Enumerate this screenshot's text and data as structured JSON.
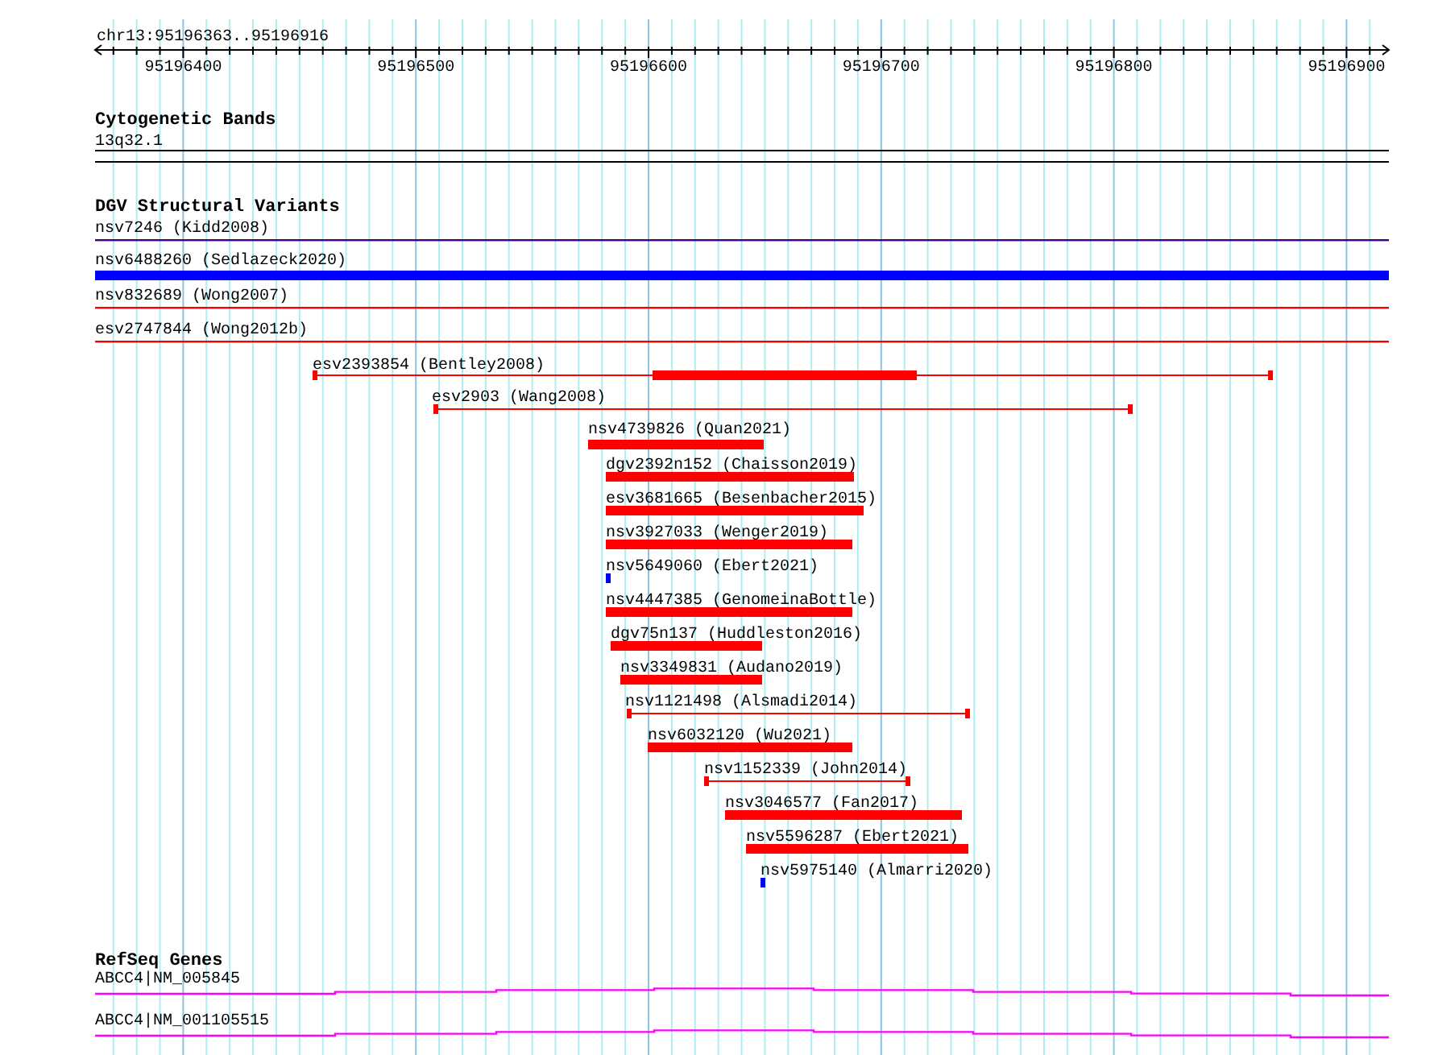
{
  "ruler": {
    "location": "chr13:95196363..95196916",
    "ticks": [
      "95196400",
      "95196500",
      "95196600",
      "95196700",
      "95196800",
      "95196900"
    ]
  },
  "tracks": [
    {
      "kind": "bands",
      "title": "Cytogenetic Bands",
      "features": [
        {
          "label": "13q32.1"
        }
      ]
    },
    {
      "kind": "variants",
      "title": "DGV Structural Variants",
      "features": [
        {
          "label": "nsv7246 (Kidd2008)",
          "kind": "line",
          "color": "#400080"
        },
        {
          "label": "nsv6488260 (Sedlazeck2020)",
          "kind": "bar",
          "color": "#0000ff"
        },
        {
          "label": "nsv832689 (Wong2007)",
          "kind": "line",
          "color": "#ff0000"
        },
        {
          "label": "esv2747844 (Wong2012b)",
          "kind": "line",
          "color": "#ff0000"
        },
        {
          "label": "esv2393854 (Bentley2008)",
          "kind": "span",
          "color": "#ff0000"
        },
        {
          "label": "esv2903 (Wang2008)",
          "kind": "span",
          "color": "#ff0000"
        },
        {
          "label": "nsv4739826 (Quan2021)",
          "kind": "bar",
          "color": "#ff0000"
        },
        {
          "label": "dgv2392n152 (Chaisson2019)",
          "kind": "bar",
          "color": "#ff0000"
        },
        {
          "label": "esv3681665 (Besenbacher2015)",
          "kind": "bar",
          "color": "#ff0000"
        },
        {
          "label": "nsv3927033 (Wenger2019)",
          "kind": "bar",
          "color": "#ff0000"
        },
        {
          "label": "nsv5649060 (Ebert2021)",
          "kind": "bar",
          "color": "#0000ff"
        },
        {
          "label": "nsv4447385 (GenomeinaBottle)",
          "kind": "bar",
          "color": "#ff0000"
        },
        {
          "label": "dgv75n137 (Huddleston2016)",
          "kind": "bar",
          "color": "#ff0000"
        },
        {
          "label": "nsv3349831 (Audano2019)",
          "kind": "bar",
          "color": "#ff0000"
        },
        {
          "label": "nsv1121498 (Alsmadi2014)",
          "kind": "span",
          "color": "#ff0000"
        },
        {
          "label": "nsv6032120 (Wu2021)",
          "kind": "bar",
          "color": "#ff0000"
        },
        {
          "label": "nsv1152339 (John2014)",
          "kind": "span",
          "color": "#ff0000"
        },
        {
          "label": "nsv3046577 (Fan2017)",
          "kind": "bar",
          "color": "#ff0000"
        },
        {
          "label": "nsv5596287 (Ebert2021)",
          "kind": "bar",
          "color": "#ff0000"
        },
        {
          "label": "nsv5975140 (Almarri2020)",
          "kind": "bar",
          "color": "#0000ff"
        }
      ]
    },
    {
      "kind": "genes",
      "title": "RefSeq Genes",
      "features": [
        {
          "label": "ABCC4|NM_005845"
        },
        {
          "label": "ABCC4|NM_001105515"
        }
      ]
    }
  ]
}
